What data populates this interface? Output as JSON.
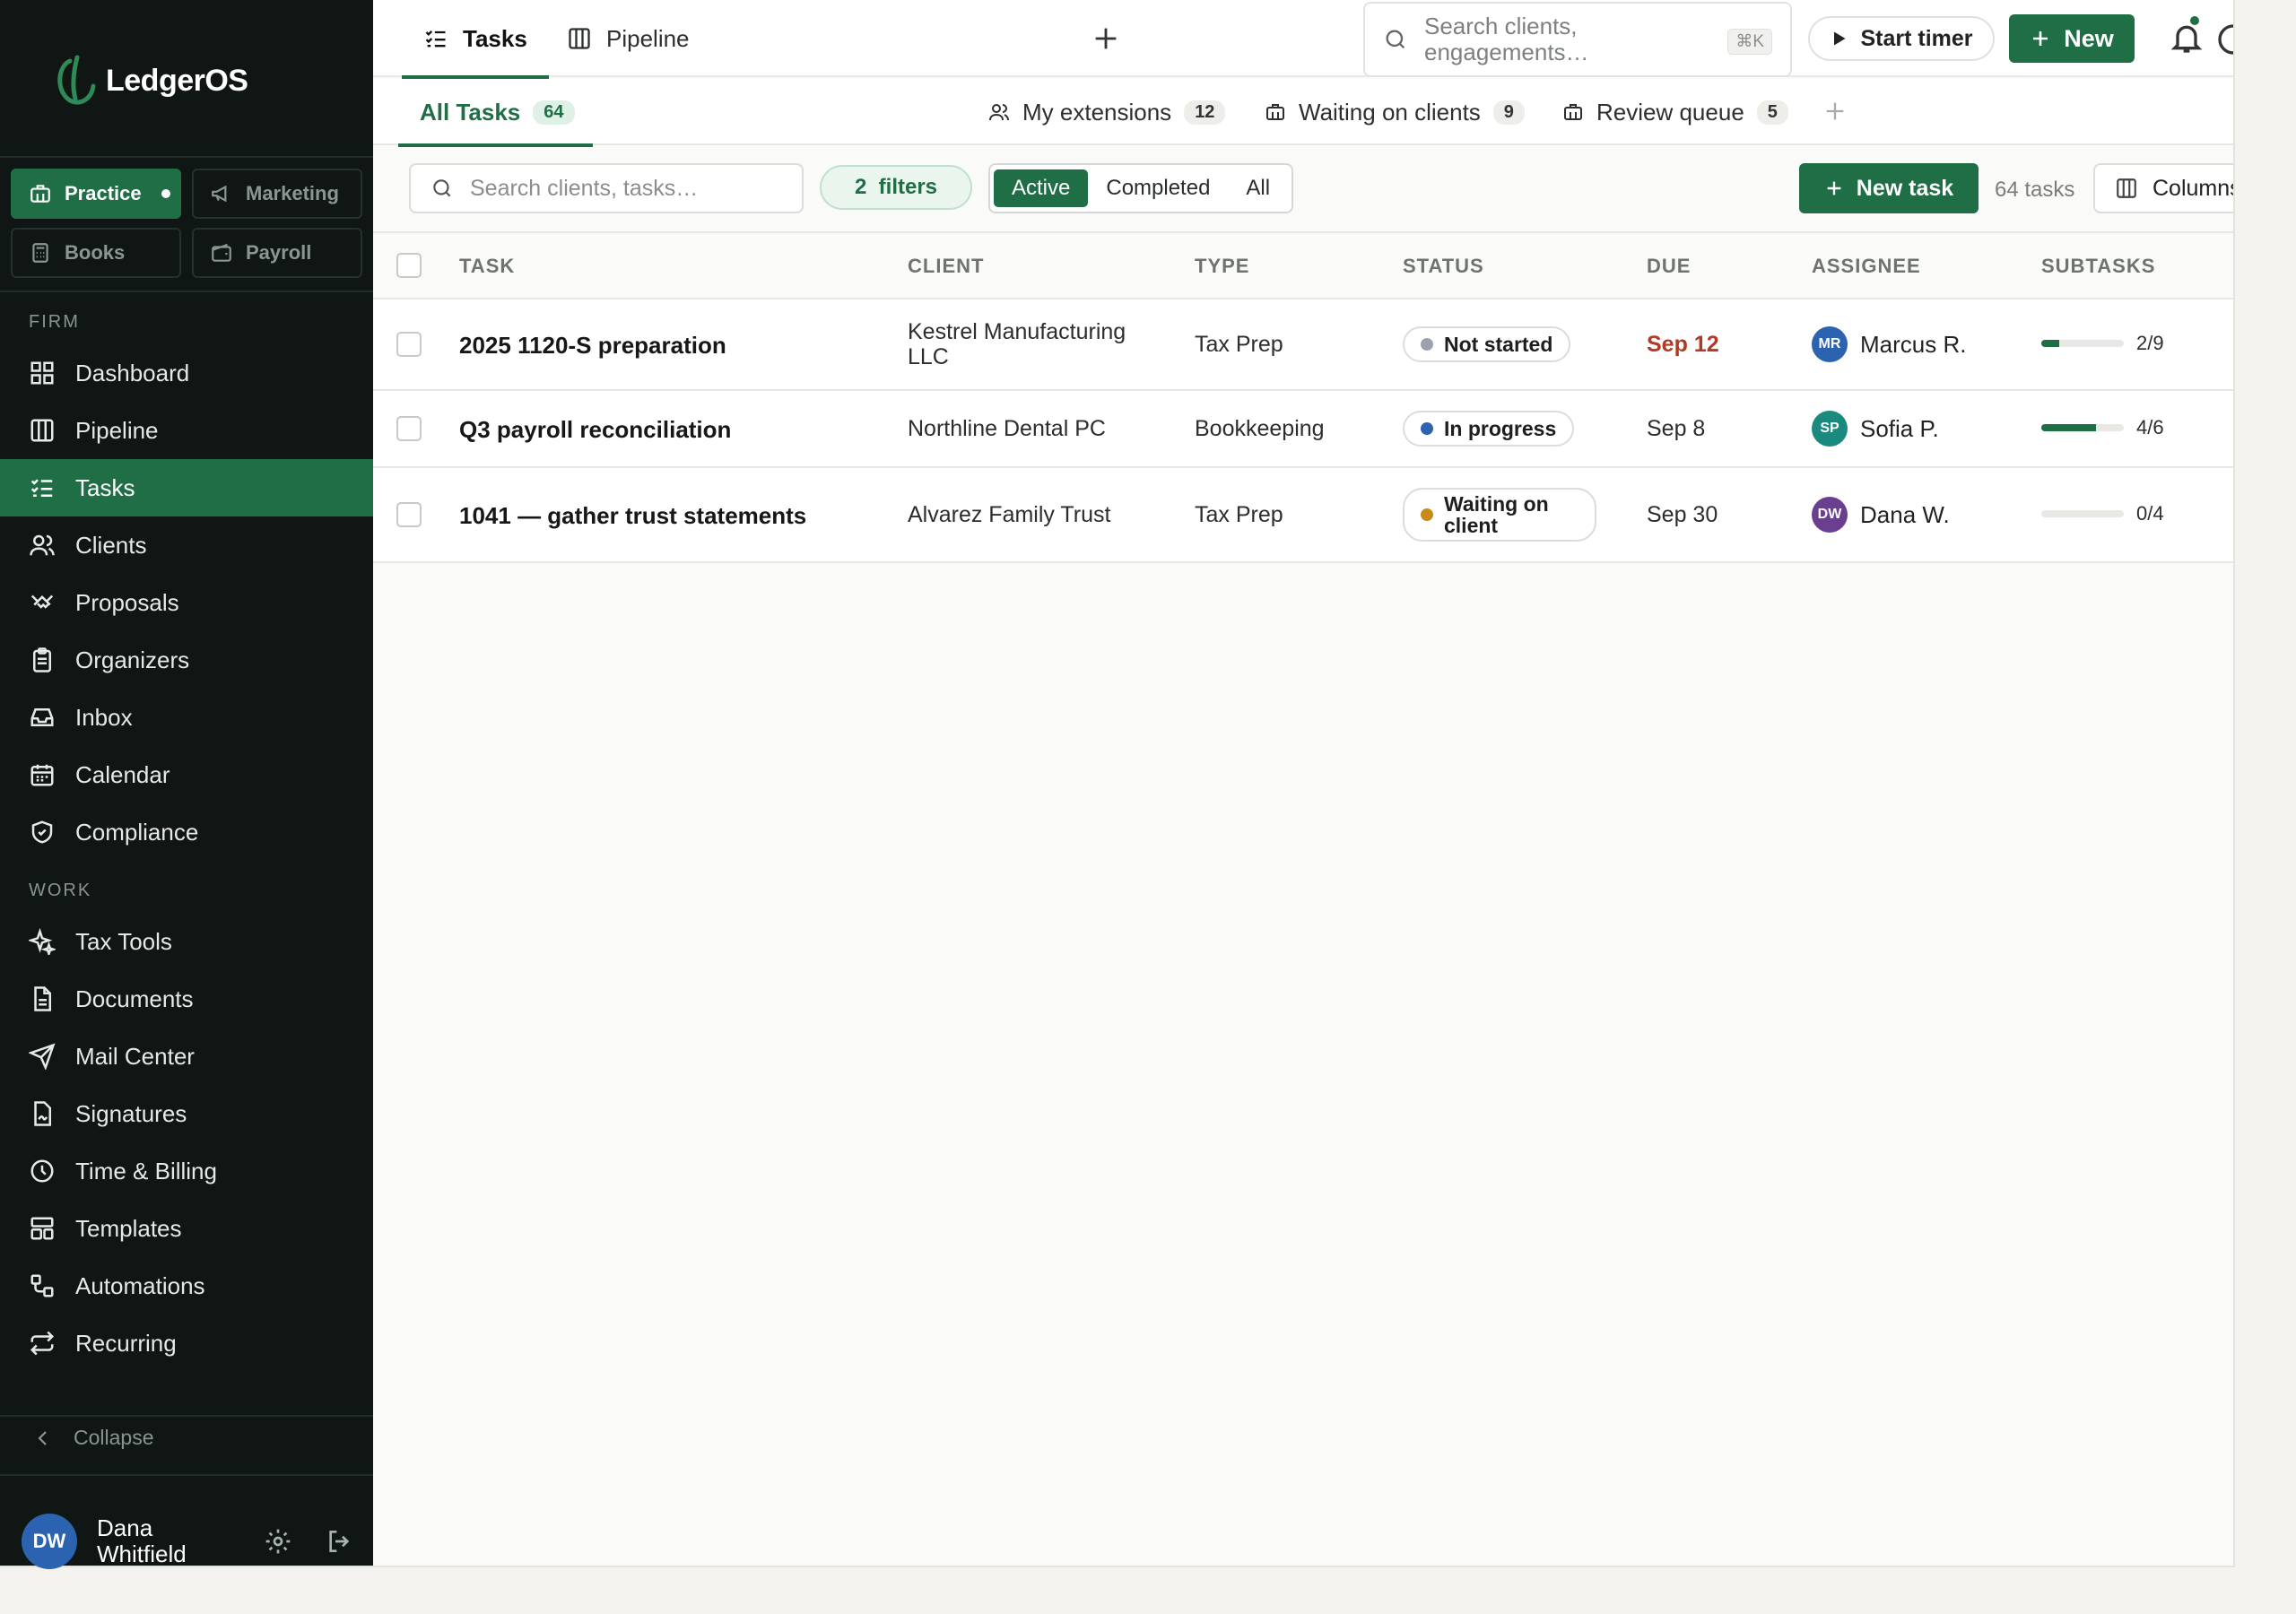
{
  "brand": {
    "name": "LedgerOS",
    "accent": "#1f6e46"
  },
  "products": [
    {
      "label": "Practice",
      "icon": "briefcase-icon",
      "active": true
    },
    {
      "label": "Marketing",
      "icon": "megaphone-icon",
      "active": false
    },
    {
      "label": "Books",
      "icon": "calculator-icon",
      "active": false
    },
    {
      "label": "Payroll",
      "icon": "wallet-icon",
      "active": false
    }
  ],
  "sidebar": {
    "firm_label": "FIRM",
    "work_label": "WORK",
    "firm_items": [
      {
        "label": "Dashboard",
        "icon": "grid-icon"
      },
      {
        "label": "Pipeline",
        "icon": "columns-icon"
      },
      {
        "label": "Tasks",
        "icon": "checklist-icon",
        "active": true
      },
      {
        "label": "Clients",
        "icon": "users-icon"
      },
      {
        "label": "Proposals",
        "icon": "handshake-icon"
      },
      {
        "label": "Organizers",
        "icon": "clipboard-icon"
      },
      {
        "label": "Inbox",
        "icon": "inbox-icon"
      },
      {
        "label": "Calendar",
        "icon": "calendar-icon"
      },
      {
        "label": "Compliance",
        "icon": "shield-icon"
      }
    ],
    "work_items": [
      {
        "label": "Tax Tools",
        "icon": "sparkle-icon"
      },
      {
        "label": "Documents",
        "icon": "document-icon"
      },
      {
        "label": "Mail Center",
        "icon": "send-icon"
      },
      {
        "label": "Signatures",
        "icon": "signature-icon"
      },
      {
        "label": "Time & Billing",
        "icon": "clock-icon"
      },
      {
        "label": "Templates",
        "icon": "template-icon"
      },
      {
        "label": "Automations",
        "icon": "workflow-icon"
      },
      {
        "label": "Recurring",
        "icon": "repeat-icon"
      }
    ],
    "collapse_label": "Collapse",
    "user": {
      "initials": "DW",
      "name": "Dana Whitfield"
    }
  },
  "topbar": {
    "tabs": [
      {
        "label": "Tasks",
        "icon": "checklist-icon",
        "active": true
      },
      {
        "label": "Pipeline",
        "icon": "columns-icon",
        "active": false
      }
    ],
    "search_placeholder": "Search clients, engagements…",
    "search_shortcut": "⌘K",
    "timer_label": "Start timer",
    "new_label": "New"
  },
  "views": [
    {
      "label": "All Tasks",
      "count": "64",
      "active": true
    },
    {
      "label": "My extensions",
      "count": "12",
      "icon": "users-icon"
    },
    {
      "label": "Waiting on clients",
      "count": "9",
      "icon": "briefcase-icon"
    },
    {
      "label": "Review queue",
      "count": "5",
      "icon": "briefcase-icon"
    }
  ],
  "toolbar": {
    "search_placeholder": "Search clients, tasks…",
    "filters_count": "2",
    "filters_label": "filters",
    "segments": [
      "Active",
      "Completed",
      "All"
    ],
    "active_segment": "Active",
    "new_task_label": "New task",
    "task_count": "64 tasks",
    "columns_label": "Columns"
  },
  "table": {
    "headers": [
      "TASK",
      "CLIENT",
      "TYPE",
      "STATUS",
      "DUE",
      "ASSIGNEE",
      "SUBTASKS"
    ],
    "rows": [
      {
        "task": "2025 1120-S preparation",
        "client": "Kestrel Manufacturing LLC",
        "type": "Tax Prep",
        "status": "Not started",
        "status_color": "#9aa3ad",
        "due": "Sep 12",
        "overdue": true,
        "assignee_initials": "MR",
        "assignee": "Marcus R.",
        "assignee_color": "#2c63b0",
        "subtasks": "2/9",
        "done": 2,
        "total": 9
      },
      {
        "task": "Q3 payroll reconciliation",
        "client": "Northline Dental PC",
        "type": "Bookkeeping",
        "status": "In progress",
        "status_color": "#2c63b0",
        "due": "Sep 8",
        "overdue": false,
        "assignee_initials": "SP",
        "assignee": "Sofia P.",
        "assignee_color": "#1a8a7e",
        "subtasks": "4/6",
        "done": 4,
        "total": 6
      },
      {
        "task": "1041 — gather trust statements",
        "client": "Alvarez Family Trust",
        "type": "Tax Prep",
        "status": "Waiting on client",
        "status_color": "#c98a1a",
        "due": "Sep 30",
        "overdue": false,
        "assignee_initials": "DW",
        "assignee": "Dana W.",
        "assignee_color": "#6b3f8f",
        "subtasks": "0/4",
        "done": 0,
        "total": 4
      }
    ]
  }
}
